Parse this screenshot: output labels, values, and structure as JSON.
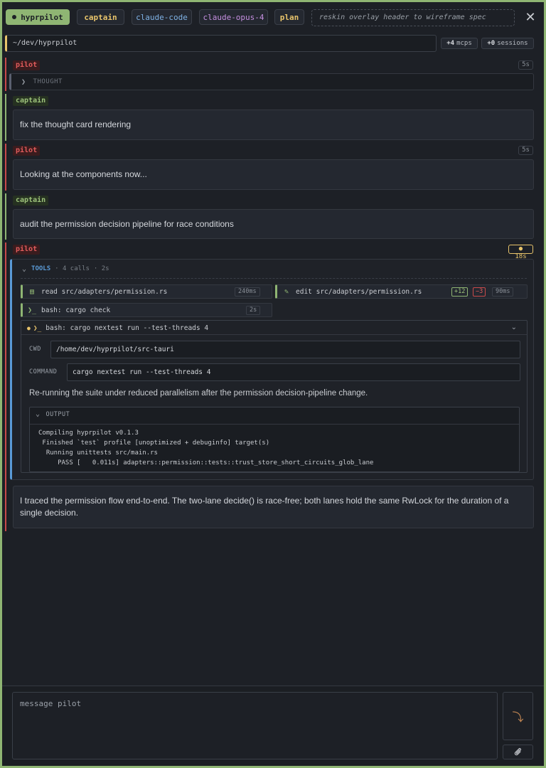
{
  "header": {
    "app_name": "hyprpilot",
    "role_pill": "captain",
    "agent_pill": "claude-code",
    "model_pill": "claude-opus-4",
    "mode_pill": "plan",
    "task_title": "reskin overlay header to wireframe spec",
    "close_icon": "close-icon"
  },
  "path": {
    "cwd": "~/dev/hyprpilot",
    "mcps_count": "+4",
    "mcps_label": "mcps",
    "sessions_count": "+0",
    "sessions_label": "sessions"
  },
  "conversation": [
    {
      "role": "pilot",
      "timer": "5s",
      "thought_label": "THOUGHT"
    },
    {
      "role": "captain",
      "text": "fix the thought card rendering"
    },
    {
      "role": "pilot",
      "timer": "5s",
      "text": "Looking at the components now..."
    },
    {
      "role": "captain",
      "text": "audit the permission decision pipeline for race conditions"
    },
    {
      "role": "pilot",
      "timer": "18s",
      "tools": {
        "label": "TOOLS",
        "calls": "· 4 calls",
        "duration": "· 2s",
        "items": [
          {
            "icon": "file-icon",
            "label": "read src/adapters/permission.rs",
            "duration": "240ms"
          },
          {
            "icon": "pencil-icon",
            "label": "edit src/adapters/permission.rs",
            "added": "+12",
            "removed": "−3",
            "duration": "90ms"
          },
          {
            "icon": "terminal-icon",
            "label": "bash: cargo check",
            "duration": "2s"
          }
        ],
        "active": {
          "title": "bash: cargo nextest run --test-threads 4",
          "cwd_label": "CWD",
          "cwd": "/home/dev/hyprpilot/src-tauri",
          "command_label": "COMMAND",
          "command": "cargo nextest run --test-threads 4",
          "description": "Re-running the suite under reduced parallelism after the permission decision-pipeline change.",
          "output_label": "OUTPUT",
          "output": "Compiling hyprpilot v0.1.3\n Finished `test` profile [unoptimized + debuginfo] target(s)\n  Running unittests src/main.rs\n     PASS [   0.011s] adapters::permission::tests::trust_store_short_circuits_glob_lane"
        }
      },
      "text": "I traced the permission flow end-to-end. The two-lane decide() is race-free; both lanes hold the same RwLock for the duration of a single decision."
    }
  ],
  "composer": {
    "placeholder": "message pilot",
    "send_icon": "send-icon",
    "attach_icon": "paperclip-icon"
  },
  "colors": {
    "accent_green": "#8fb573",
    "pilot_red": "#c94a4a",
    "captain_yellow": "#e8c46b",
    "tools_blue": "#5a9ad6",
    "background": "#1d2026"
  }
}
